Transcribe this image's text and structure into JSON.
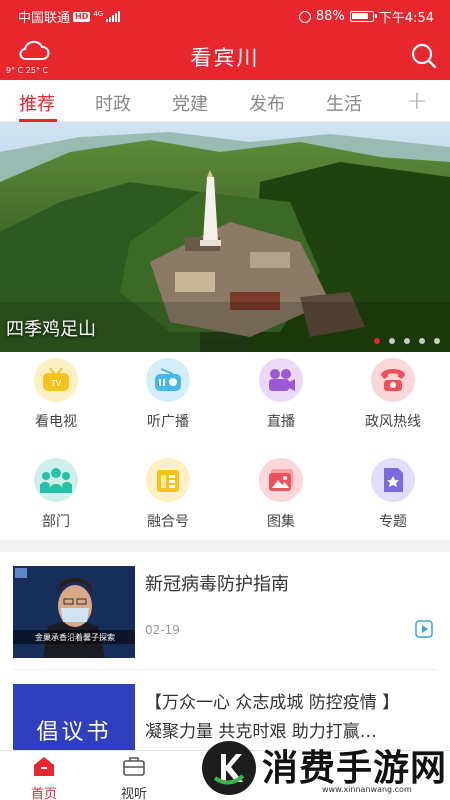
{
  "status_bar": {
    "carrier": "中国联通",
    "network_badge": "HD",
    "network_type": "4G",
    "battery_percent": "88%",
    "time": "下午4:54"
  },
  "header": {
    "title": "看宾川",
    "weather_temp": "9° C 25° C",
    "weather_icon": "cloud-icon",
    "search_icon": "search-icon",
    "bg_color": "#e8262d"
  },
  "tabs": {
    "items": [
      {
        "label": "推荐",
        "active": true
      },
      {
        "label": "时政",
        "active": false
      },
      {
        "label": "党建",
        "active": false
      },
      {
        "label": "发布",
        "active": false
      },
      {
        "label": "生活",
        "active": false
      }
    ],
    "add_label": "+"
  },
  "banner": {
    "caption": "四季鸡足山",
    "slide_count": 5,
    "active_slide": 1
  },
  "grid": {
    "items": [
      {
        "label": "看电视",
        "icon": "tv-icon",
        "color": "#f7c21b",
        "bg": "#fdf0c4"
      },
      {
        "label": "听广播",
        "icon": "radio-icon",
        "color": "#45b7e8",
        "bg": "#d4eefb"
      },
      {
        "label": "直播",
        "icon": "camera-icon",
        "color": "#9b59d6",
        "bg": "#ead9f7"
      },
      {
        "label": "政风热线",
        "icon": "phone-icon",
        "color": "#f0505a",
        "bg": "#fcd7da"
      },
      {
        "label": "部门",
        "icon": "people-icon",
        "color": "#26c1a6",
        "bg": "#cdf1ea"
      },
      {
        "label": "融合号",
        "icon": "card-icon",
        "color": "#f7c21b",
        "bg": "#fdf0c4"
      },
      {
        "label": "图集",
        "icon": "gallery-icon",
        "color": "#f0505a",
        "bg": "#fcd7da"
      },
      {
        "label": "专题",
        "icon": "topic-icon",
        "color": "#7b6be0",
        "bg": "#e2ddf9"
      }
    ]
  },
  "news": [
    {
      "title": "新冠病毒防护指南",
      "date": "02-19",
      "thumb_caption": "金巢承香沿着馨子探索",
      "has_video": true
    },
    {
      "title_line1": "【万众一心 众志成城 防控疫情 】",
      "title_line2": "凝聚力量 共克时艰 助力打赢…",
      "thumb_text": "倡议书"
    }
  ],
  "bottom_nav": {
    "items": [
      {
        "label": "首页",
        "icon": "home-icon",
        "active": true
      },
      {
        "label": "视听",
        "icon": "media-box-icon",
        "active": false
      }
    ]
  },
  "watermark": {
    "text": "消费手游网",
    "url": "www.xinnanwang.com"
  }
}
